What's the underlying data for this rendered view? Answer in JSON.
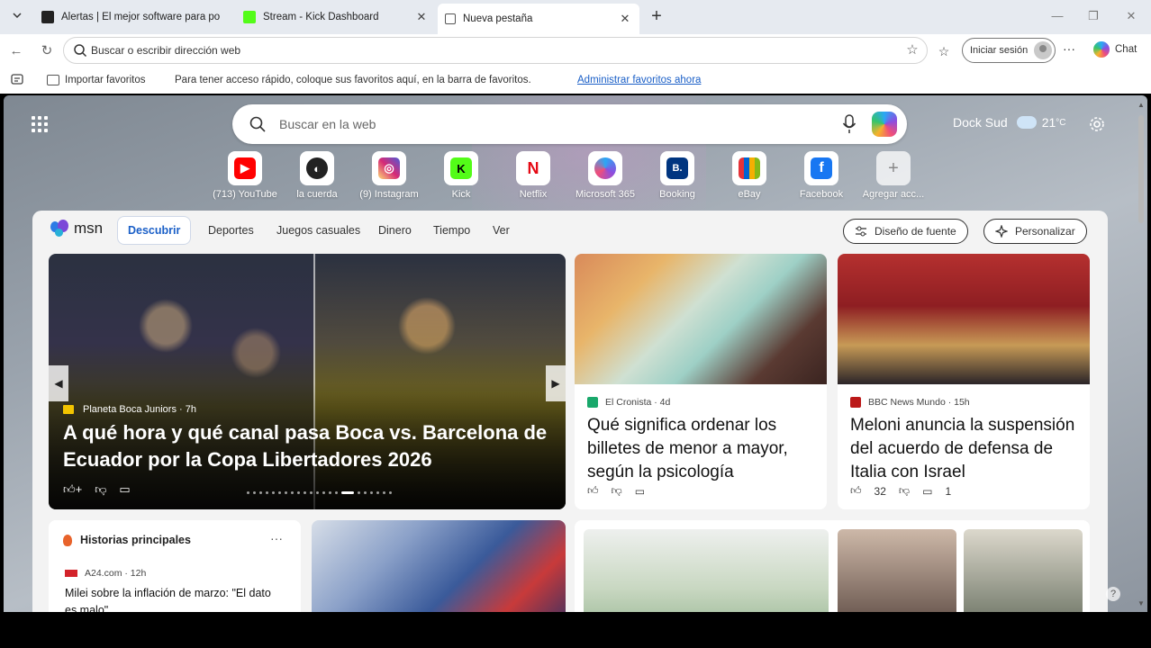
{
  "tabs": [
    {
      "title": "Alertas | El mejor software para po",
      "icon": "shield-icon"
    },
    {
      "title": "Stream - Kick Dashboard",
      "icon": "kick-icon"
    },
    {
      "title": "Nueva pestaña",
      "icon": "newtab-icon",
      "active": true
    }
  ],
  "address_bar": {
    "placeholder": "Buscar o escribir dirección web"
  },
  "toolbar": {
    "signin_label": "Iniciar sesión",
    "chat_label": "Chat"
  },
  "favorites_bar": {
    "import_label": "Importar favoritos",
    "message": "Para tener acceso rápido, coloque sus favoritos aquí, en la barra de favoritos.",
    "manage_link": "Administrar favoritos ahora"
  },
  "ntp": {
    "search_placeholder": "Buscar en la web",
    "location": "Dock Sud",
    "temperature": "21",
    "temp_unit": "°C"
  },
  "quick_links": [
    {
      "label": "(713) YouTube",
      "icon": "youtube-icon",
      "color": "#ff0000"
    },
    {
      "label": "la cuerda",
      "icon": "lacuerda-icon",
      "color": "#222222"
    },
    {
      "label": "(9) Instagram",
      "icon": "instagram-icon",
      "color": "#d62976"
    },
    {
      "label": "Kick",
      "icon": "kick-icon",
      "color": "#53fc18"
    },
    {
      "label": "Netflix",
      "icon": "netflix-icon",
      "color": "#e50914"
    },
    {
      "label": "Microsoft 365",
      "icon": "microsoft365-icon",
      "color": "#4f6bed"
    },
    {
      "label": "Booking",
      "icon": "booking-icon",
      "color": "#003580"
    },
    {
      "label": "eBay",
      "icon": "ebay-icon",
      "color": "#86b817"
    },
    {
      "label": "Facebook",
      "icon": "facebook-icon",
      "color": "#1877f2"
    },
    {
      "label": "Agregar acc...",
      "icon": "plus-icon",
      "color": "#ffffff"
    }
  ],
  "feed": {
    "logo_text": "msn",
    "nav": [
      "Descubrir",
      "Deportes",
      "Juegos casuales",
      "Dinero",
      "Tiempo",
      "Ver"
    ],
    "font_button": "Diseño de fuente",
    "personalize_button": "Personalizar",
    "hero": {
      "source": "Planeta Boca Juniors · 7h",
      "title": "A qué hora y qué canal pasa Boca vs. Barcelona de Ecuador por la Copa Libertadores 2026"
    },
    "cards": [
      {
        "source": "El Cronista · 4d",
        "title": "Qué significa ordenar los billetes de menor a mayor, según la psicología",
        "likes": "",
        "comments": ""
      },
      {
        "source": "BBC News Mundo · 15h",
        "title": "Meloni anuncia la suspensión del acuerdo de defensa de Italia con Israel",
        "likes": "32",
        "comments": "1"
      }
    ],
    "top_stories": {
      "heading": "Historias principales",
      "source": "A24.com · 12h",
      "title": "Milei sobre la inflación de marzo: \"El dato es malo\""
    }
  },
  "colors": {
    "accent": "#1a5fc7",
    "tabstrip": "#e6eaf0"
  }
}
